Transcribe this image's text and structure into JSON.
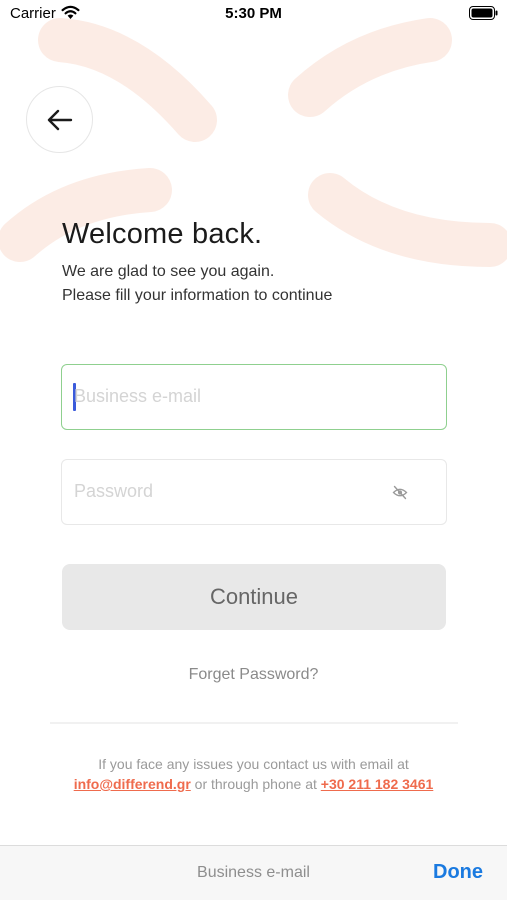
{
  "status_bar": {
    "carrier": "Carrier",
    "time": "5:30 PM"
  },
  "header": {
    "back_icon": "arrow-left-icon"
  },
  "welcome": {
    "title": "Welcome back.",
    "subtitle_line1": "We are glad to see you again.",
    "subtitle_line2": "Please fill your information to continue"
  },
  "form": {
    "email_placeholder": "Business e-mail",
    "password_placeholder": "Password",
    "password_toggle_icon": "eye-off-icon",
    "continue_label": "Continue",
    "forgot_label": "Forget Password?"
  },
  "contact": {
    "text_before": "If you face any issues you contact us with email at",
    "email": "info@differend.gr",
    "text_middle": "or through phone at",
    "phone": "+30 211 182 3461"
  },
  "keyboard_toolbar": {
    "field_label": "Business e-mail",
    "done_label": "Done"
  },
  "colors": {
    "accent": "#ef6b4d",
    "focus_border": "#8fd08f",
    "done_blue": "#1a7ae0",
    "decoration": "#fbe3d6"
  }
}
